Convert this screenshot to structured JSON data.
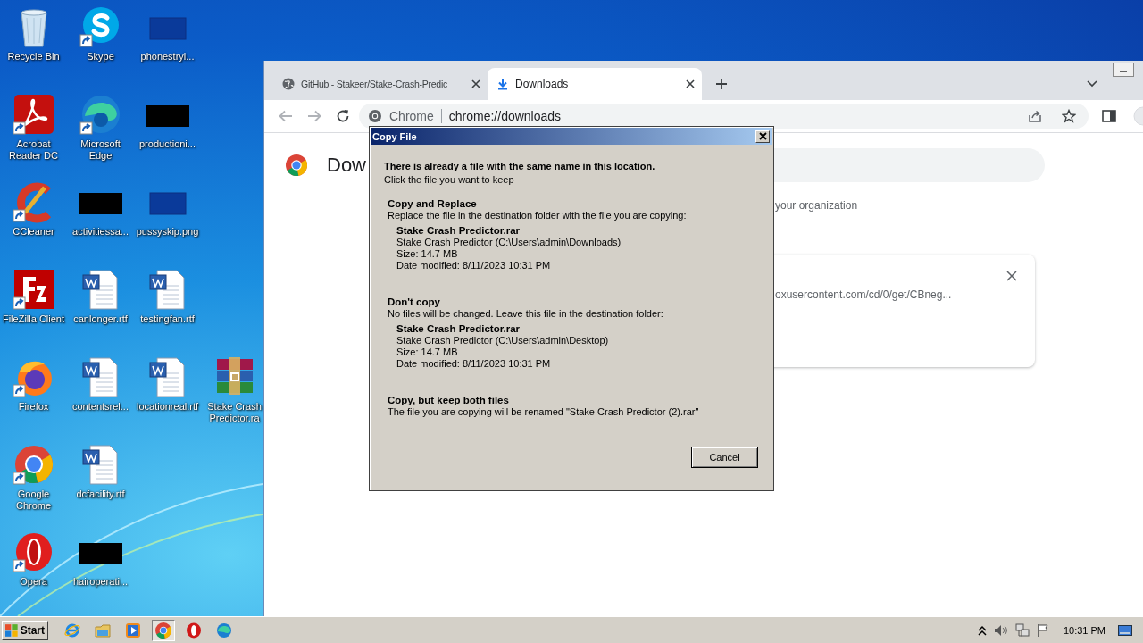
{
  "desktop": {
    "rows": [
      [
        {
          "label": "Recycle Bin",
          "kind": "recycle",
          "shortcut": false
        },
        {
          "label": "Skype",
          "kind": "skype",
          "shortcut": true
        },
        {
          "label": "phonestryi...",
          "kind": "blank",
          "shortcut": false
        }
      ],
      [
        {
          "label": "Acrobat Reader DC",
          "kind": "acrobat",
          "shortcut": true
        },
        {
          "label": "Microsoft Edge",
          "kind": "edge",
          "shortcut": true
        },
        {
          "label": "productioni...",
          "kind": "redacted",
          "shortcut": false
        }
      ],
      [
        {
          "label": "CCleaner",
          "kind": "ccleaner",
          "shortcut": true
        },
        {
          "label": "activitiessa...",
          "kind": "redacted",
          "shortcut": false
        },
        {
          "label": "pussyskip.png",
          "kind": "blank",
          "shortcut": false
        }
      ],
      [
        {
          "label": "FileZilla Client",
          "kind": "filezilla",
          "shortcut": true
        },
        {
          "label": "canlonger.rtf",
          "kind": "word",
          "shortcut": false
        },
        {
          "label": "testingfan.rtf",
          "kind": "word",
          "shortcut": false
        }
      ],
      [
        {
          "label": "Firefox",
          "kind": "firefox",
          "shortcut": true
        },
        {
          "label": "contentsrel...",
          "kind": "word",
          "shortcut": false
        },
        {
          "label": "locationreal.rtf",
          "kind": "word",
          "shortcut": false
        },
        {
          "label": "Stake Crash Predictor.ra",
          "kind": "winrar",
          "shortcut": false
        }
      ],
      [
        {
          "label": "Google Chrome",
          "kind": "chrome",
          "shortcut": true
        },
        {
          "label": "dcfacility.rtf",
          "kind": "word",
          "shortcut": false
        }
      ],
      [
        {
          "label": "Opera",
          "kind": "opera",
          "shortcut": true
        },
        {
          "label": "hairoperati...",
          "kind": "redacted",
          "shortcut": false
        }
      ]
    ]
  },
  "browser": {
    "tabs": [
      {
        "title": "GitHub - Stakeer/Stake-Crash-Predic",
        "kind": "web",
        "selected": false
      },
      {
        "title": "Downloads",
        "kind": "download",
        "selected": true
      }
    ],
    "address": {
      "origin": "Chrome",
      "url": "chrome://downloads"
    },
    "page": {
      "heading": "Dow",
      "notice": "your organization",
      "download": {
        "url": "oxusercontent.com/cd/0/get/CBneg..."
      }
    }
  },
  "dialog": {
    "title": "Copy File",
    "heading": "There is already a file with the same name in this location.",
    "subheading": "Click the file you want to keep",
    "options": [
      {
        "title": "Copy and Replace",
        "description": "Replace the file in the destination folder with the file you are copying:",
        "file": {
          "name": "Stake Crash Predictor.rar",
          "location": "Stake Crash Predictor (C:\\Users\\admin\\Downloads)",
          "size": "Size: 14.7 MB",
          "modified": "Date modified: 8/11/2023 10:31 PM"
        }
      },
      {
        "title": "Don't copy",
        "description": "No files will be changed. Leave this file in the destination folder:",
        "file": {
          "name": "Stake Crash Predictor.rar",
          "location": "Stake Crash Predictor (C:\\Users\\admin\\Desktop)",
          "size": "Size: 14.7 MB",
          "modified": "Date modified: 8/11/2023 10:31 PM"
        }
      },
      {
        "title": "Copy, but keep both files",
        "description": "The file you are copying will be renamed \"Stake Crash Predictor (2).rar\""
      }
    ],
    "cancel": "Cancel"
  },
  "taskbar": {
    "start": "Start",
    "apps": [
      {
        "kind": "ie",
        "active": false
      },
      {
        "kind": "explorer",
        "active": false
      },
      {
        "kind": "media",
        "active": false
      },
      {
        "kind": "chrome",
        "active": true
      },
      {
        "kind": "opera",
        "active": false
      },
      {
        "kind": "edge",
        "active": false
      }
    ],
    "clock": "10:31 PM"
  }
}
